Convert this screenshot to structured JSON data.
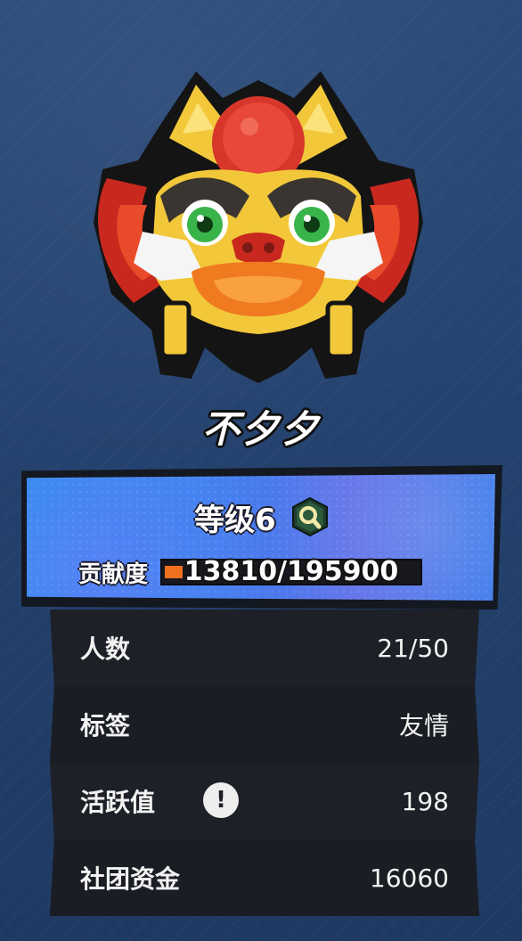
{
  "club": {
    "name": "不夕夕",
    "emblem_icon": "lion-dance-head-emblem"
  },
  "level_panel": {
    "level_text": "等级6",
    "level_badge_icon": "magnifier-hexagon-icon",
    "contribution_label": "贡献度",
    "contribution_value": "13810/195900",
    "contribution_current": 13810,
    "contribution_max": 195900
  },
  "info": {
    "rows": [
      {
        "label": "人数",
        "value": "21/50"
      },
      {
        "label": "标签",
        "value": "友情"
      },
      {
        "label": "活跃值",
        "value": "198",
        "icon": "info-exclamation-icon",
        "icon_glyph": "!"
      },
      {
        "label": "社团资金",
        "value": "16060"
      }
    ]
  },
  "colors": {
    "background": "#24426e",
    "panel_blue": "#3a86ef",
    "bar_fill": "#f07020",
    "row_dark": "#1c1f26"
  }
}
